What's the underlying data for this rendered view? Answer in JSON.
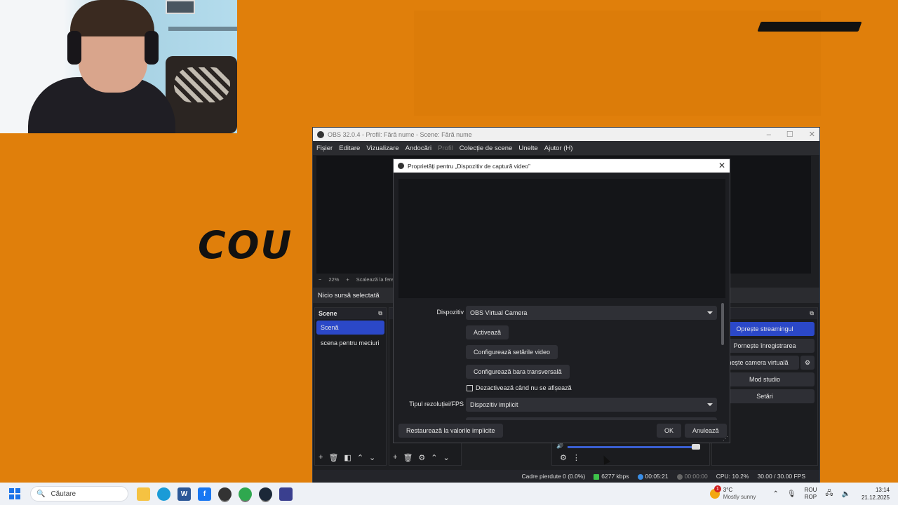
{
  "obs": {
    "window_title": "OBS 32.0.4 - Profil: Fără nume - Scene: Fără nume",
    "menu": [
      "Fișier",
      "Editare",
      "Vizualizare",
      "Andocări",
      "Profil",
      "Colecție de scene",
      "Unelte",
      "Ajutor (H)"
    ],
    "zoom_minus": "−",
    "zoom_value": "22%",
    "zoom_plus": "+",
    "zoom_fit": "Scalează la fere",
    "source_status": "Nicio sursă selectată",
    "scenes_header": "Scene",
    "sources_header": "S",
    "scenes": [
      "Scenă",
      "scena pentru meciuri"
    ],
    "controls_header": "enzi",
    "controls": {
      "stream": "Oprește streamingul",
      "record": "Pornește înregistrarea",
      "virtualcam": "rnește camera virtuală",
      "studio": "Mod studio",
      "settings": "Setări"
    },
    "status": {
      "dropped": "Cadre pierdute 0 (0.0%)",
      "kbps": "6277 kbps",
      "stream_time": "00:05:21",
      "rec_time": "00:00:00",
      "cpu": "CPU: 10.2%",
      "fps": "30.00 / 30.00 FPS"
    }
  },
  "dialog": {
    "title": "Proprietăți pentru „Dispozitiv de captură video”",
    "device_label": "Dispozitiv",
    "device_value": "OBS Virtual Camera",
    "activate": "Activează",
    "config_video": "Configurează setările video",
    "config_crossbar": "Configurează bara transversală",
    "deactivate_checkbox": "Dezactivează când nu se afișează",
    "deactivate_checked": false,
    "resolution_label": "Tipul rezoluției/FPS",
    "resolution_value": "Dispozitiv implicit",
    "restore": "Restaurează la valorile implicite",
    "ok": "OK",
    "cancel": "Anulează"
  },
  "taskbar": {
    "search_placeholder": "Căutare",
    "weather_temp": "3°C",
    "weather_desc": "Mostly sunny",
    "weather_badge": "1",
    "lang_1": "ROU",
    "lang_2": "ROP",
    "time": "13:14",
    "date": "21.12.2025"
  },
  "colors": {
    "desktop": "#e07f0b",
    "obs_accent": "#2b48c8"
  }
}
